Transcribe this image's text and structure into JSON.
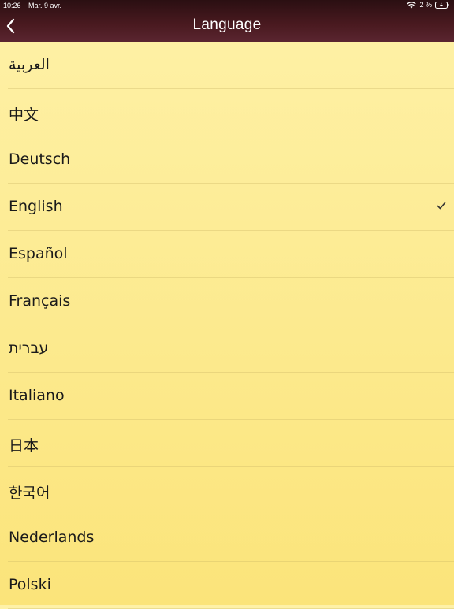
{
  "status_bar": {
    "time": "10:26",
    "date": "Mar. 9 avr.",
    "battery": "2 %"
  },
  "nav": {
    "title": "Language",
    "back_icon": "chevron-left-icon"
  },
  "languages": [
    {
      "label": "العربية",
      "selected": false
    },
    {
      "label": "中文",
      "selected": false
    },
    {
      "label": "Deutsch",
      "selected": false
    },
    {
      "label": "English",
      "selected": true
    },
    {
      "label": "Español",
      "selected": false
    },
    {
      "label": "Français",
      "selected": false
    },
    {
      "label": "עברית",
      "selected": false
    },
    {
      "label": "Italiano",
      "selected": false
    },
    {
      "label": "日本",
      "selected": false
    },
    {
      "label": "한국어",
      "selected": false
    },
    {
      "label": "Nederlands",
      "selected": false
    },
    {
      "label": "Polski",
      "selected": false
    }
  ],
  "colors": {
    "header_dark": "#2a0f12",
    "header_light": "#5a2530",
    "list_bg_top": "#fef1a7",
    "list_bg_bottom": "#fbe47a",
    "text": "#1a1a1a"
  }
}
